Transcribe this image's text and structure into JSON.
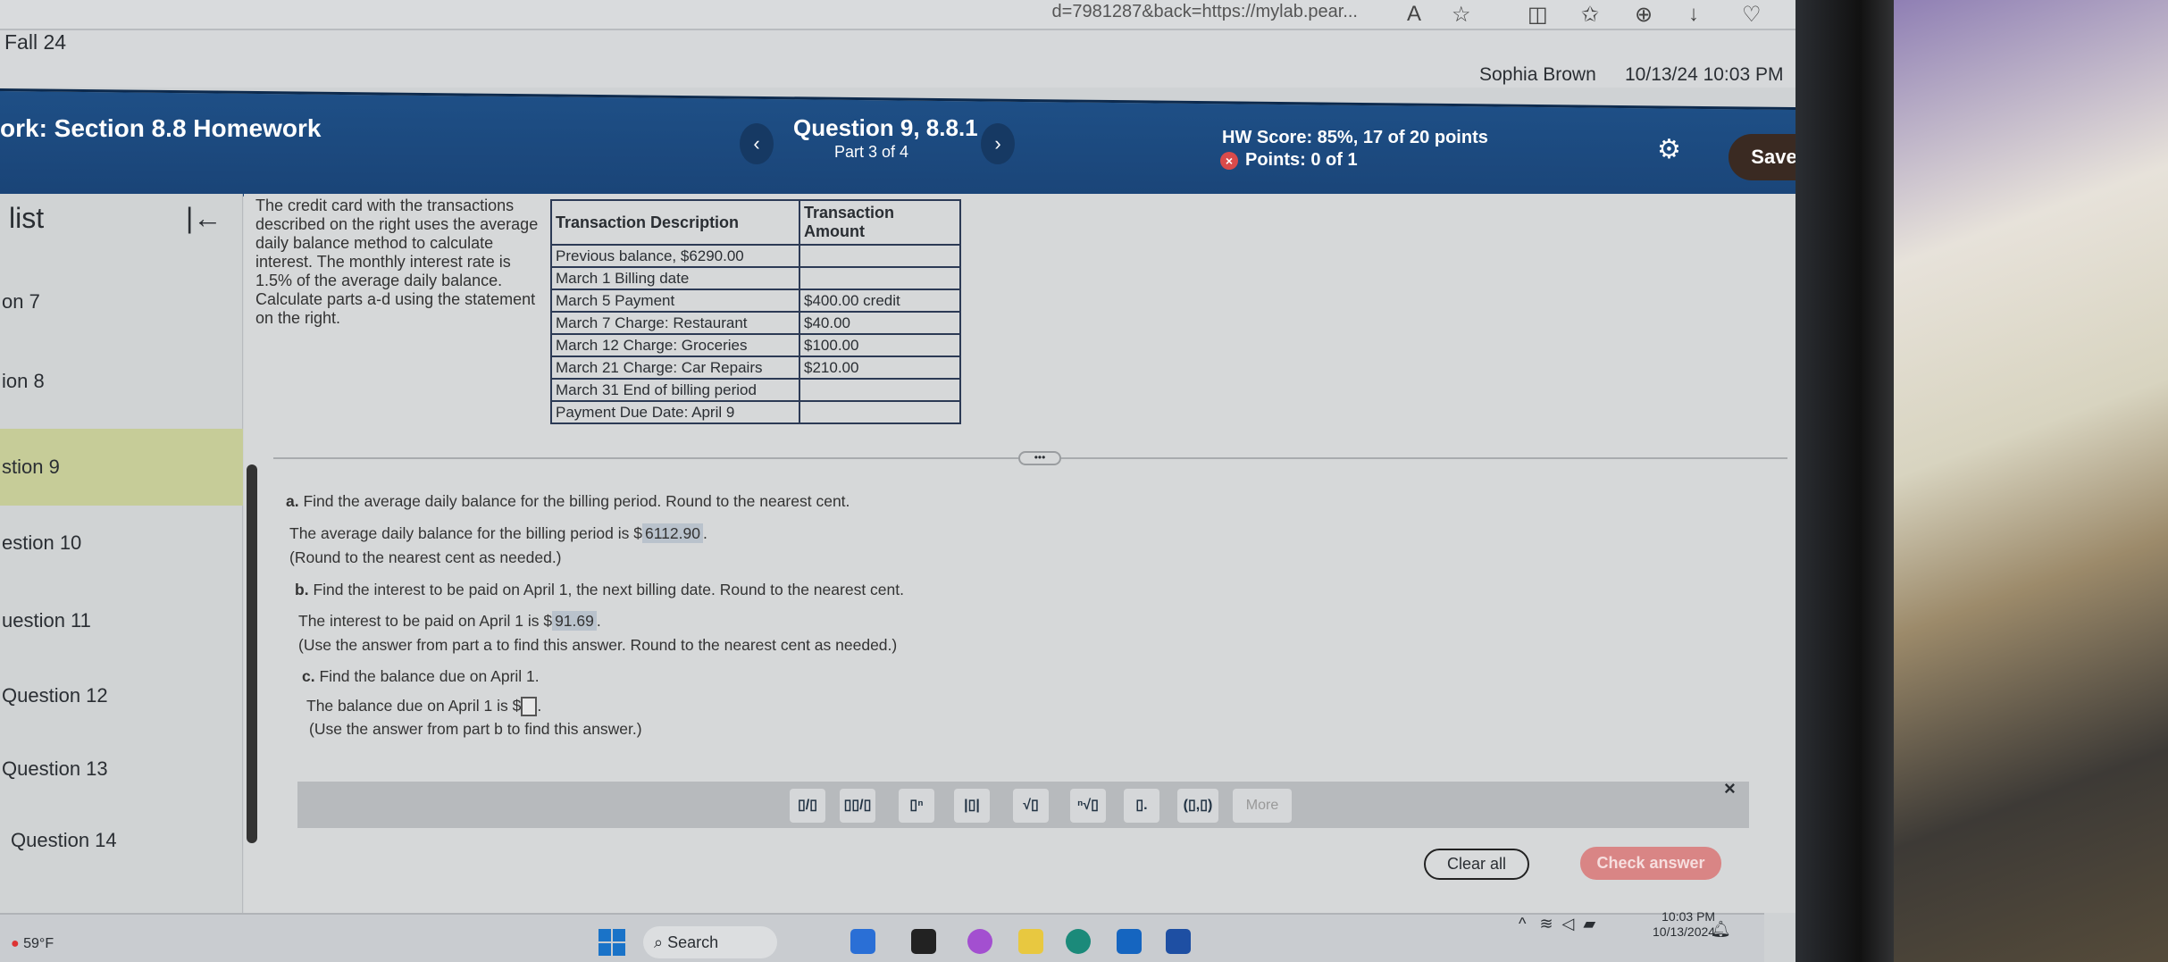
{
  "browser": {
    "url_fragment": "d=7981287&back=https://mylab.pear..."
  },
  "course": "Fall 24",
  "user": {
    "name": "Sophia Brown",
    "datetime": "10/13/24 10:03 PM"
  },
  "header": {
    "title": "ork:  Section 8.8 Homework",
    "question": "Question 9, 8.8.1",
    "part": "Part 3 of 4",
    "hw_score": "HW Score: 85%, 17 of 20 points",
    "points": "Points: 0 of 1",
    "save": "Save"
  },
  "sidebar": {
    "heading": "list",
    "items": [
      {
        "label": "on 7"
      },
      {
        "label": "ion 8"
      },
      {
        "label": "stion 9",
        "active": true
      },
      {
        "label": "estion 10"
      },
      {
        "label": "uestion 11"
      },
      {
        "label": "Question 12"
      },
      {
        "label": "Question 13"
      },
      {
        "label": "Question 14"
      }
    ]
  },
  "problem": {
    "intro": "The credit card with the transactions described on the right uses the average daily balance method to calculate interest. The monthly interest rate is 1.5% of the average daily balance. Calculate parts a-d using the statement on the right.",
    "table": {
      "headers": [
        "Transaction Description",
        "Transaction Amount"
      ],
      "rows": [
        [
          "Previous balance, $6290.00",
          ""
        ],
        [
          "March 1 Billing date",
          ""
        ],
        [
          "March 5 Payment",
          "$400.00 credit"
        ],
        [
          "March 7 Charge: Restaurant",
          "$40.00"
        ],
        [
          "March 12 Charge: Groceries",
          "$100.00"
        ],
        [
          "March 21 Charge: Car Repairs",
          "$210.00"
        ],
        [
          "March 31 End of billing period",
          ""
        ],
        [
          "Payment Due Date: April 9",
          ""
        ]
      ]
    },
    "a": {
      "label": "a.",
      "prompt": "Find the average daily balance for the billing period. Round to the nearest cent.",
      "answer_pre": "The average daily balance for the billing period is $",
      "answer": "6112.90",
      "note": "(Round to the nearest cent as needed.)"
    },
    "b": {
      "label": "b.",
      "prompt": "Find the interest to be paid on April 1, the next billing date. Round to the nearest cent.",
      "answer_pre": "The interest to be paid on April 1 is $",
      "answer": "91.69",
      "note": "(Use the answer from part a to find this answer. Round to the nearest cent as needed.)"
    },
    "c": {
      "label": "c.",
      "prompt": "Find the balance due on April 1.",
      "answer_pre": "The balance due on April 1 is $",
      "answer": "",
      "note": "(Use the answer from part b to find this answer.)"
    }
  },
  "mathbar": {
    "buttons": [
      "▯/▯",
      "▯▯/▯",
      "▯ⁿ",
      "|▯|",
      "√▯",
      "ⁿ√▯",
      "▯.",
      "(▯,▯)"
    ],
    "more": "More"
  },
  "actions": {
    "clear": "Clear all",
    "check": "Check answer"
  },
  "taskbar": {
    "weather": "59°F",
    "search": "Search",
    "time": "10:03 PM",
    "date": "10/13/2024"
  },
  "colors": {
    "header_blue": "#1e4f86",
    "active_item": "#c6cc98",
    "check_answer": "#d98585"
  }
}
